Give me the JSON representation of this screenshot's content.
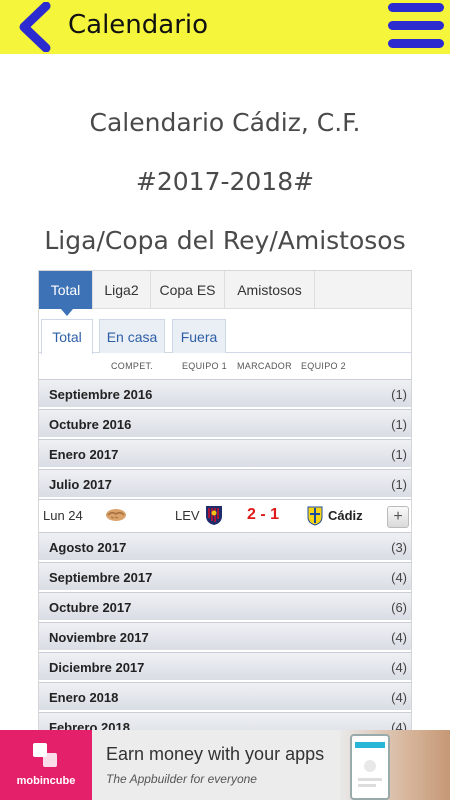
{
  "topbar": {
    "title": "Calendario",
    "back_icon": "chevron-left-icon",
    "menu_icon": "hamburger-menu-icon",
    "bg_color": "#f5f53c",
    "accent_color": "#2b2bd0"
  },
  "headings": {
    "line1": "Calendario Cádiz, C.F.",
    "line2": "#2017-2018#",
    "line3": "Liga/Copa del Rey/Amistosos"
  },
  "tabs_competition": [
    "Total",
    "Liga2",
    "Copa ES",
    "Amistosos"
  ],
  "tabs_venue": [
    "Total",
    "En casa",
    "Fuera"
  ],
  "columns": {
    "compet": "COMPET.",
    "equipo1": "EQUIPO 1",
    "marcador": "MARCADOR",
    "equipo2": "EQUIPO 2"
  },
  "months": [
    {
      "month": "Septiembre 2016",
      "count": "(1)"
    },
    {
      "month": "Octubre 2016",
      "count": "(1)"
    },
    {
      "month": "Enero 2017",
      "count": "(1)"
    },
    {
      "month": "Julio 2017",
      "count": "(1)"
    },
    {
      "month": "Agosto 2017",
      "count": "(3)"
    },
    {
      "month": "Septiembre 2017",
      "count": "(4)"
    },
    {
      "month": "Octubre 2017",
      "count": "(6)"
    },
    {
      "month": "Noviembre 2017",
      "count": "(4)"
    },
    {
      "month": "Diciembre 2017",
      "count": "(4)"
    },
    {
      "month": "Enero 2018",
      "count": "(4)"
    },
    {
      "month": "Febrero 2018",
      "count": "(4)"
    }
  ],
  "match": {
    "date": "Lun 24",
    "competition_icon": "handshake-icon",
    "team1": "LEV",
    "team1_badge": "levante-badge-icon",
    "score": "2 - 1",
    "team2": "Cádiz",
    "team2_badge": "cadiz-badge-icon",
    "expand_label": "+"
  },
  "ad": {
    "brand": "mobincube",
    "title": "Earn money with your apps",
    "subtitle": "The Appbuilder for everyone",
    "brand_color": "#e5206b"
  }
}
